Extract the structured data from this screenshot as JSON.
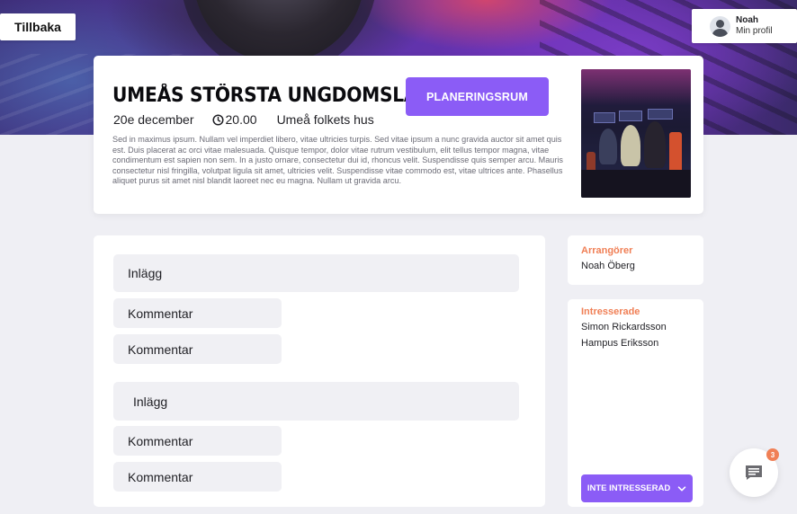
{
  "nav": {
    "back_label": "Tillbaka"
  },
  "profile": {
    "name": "Noah",
    "subtitle": "Min profil",
    "avatar_icon": "user-avatar-icon"
  },
  "event": {
    "title": "UMEÅS STÖRSTA UNGDOMSLAN",
    "planning_button": "PLANERINGSRUM",
    "date": "20e december",
    "time": "20.00",
    "time_icon": "clock-icon",
    "location": "Umeå folkets hus",
    "description": "Sed in maximus ipsum. Nullam vel imperdiet libero, vitae ultricies turpis. Sed vitae ipsum a nunc gravida auctor sit amet quis est. Duis placerat ac orci vitae malesuada. Quisque tempor, dolor vitae rutrum vestibulum, elit tellus tempor magna, vitae condimentum est sapien non sem. In a justo ornare, consectetur dui id, rhoncus velit. Suspendisse quis semper arcu. Mauris consectetur nisl fringilla, volutpat ligula sit amet, ultricies velit. Suspendisse vitae commodo est, vitae ultrices ante. Phasellus aliquet purus sit amet nisl blandit laoreet nec eu magna. Nullam ut gravida arcu."
  },
  "feed": {
    "items": [
      {
        "type": "post",
        "label": "Inlägg"
      },
      {
        "type": "comment",
        "label": "Kommentar"
      },
      {
        "type": "comment",
        "label": "Kommentar"
      },
      {
        "type": "post",
        "label": "Inlägg"
      },
      {
        "type": "comment",
        "label": "Kommentar"
      },
      {
        "type": "comment",
        "label": "Kommentar"
      }
    ]
  },
  "organizers": {
    "title": "Arrangörer",
    "names": [
      "Noah Öberg"
    ]
  },
  "interested": {
    "title": "Intresserade",
    "names": [
      "Simon Rickardsson",
      "Hampus Eriksson"
    ],
    "button_label": "INTE INTRESSERAD",
    "button_icon": "chevron-down-icon"
  },
  "chat": {
    "icon": "chat-icon",
    "badge_count": "3"
  },
  "colors": {
    "accent": "#8b5cf6",
    "highlight": "#f07f55",
    "background": "#efeff4"
  }
}
